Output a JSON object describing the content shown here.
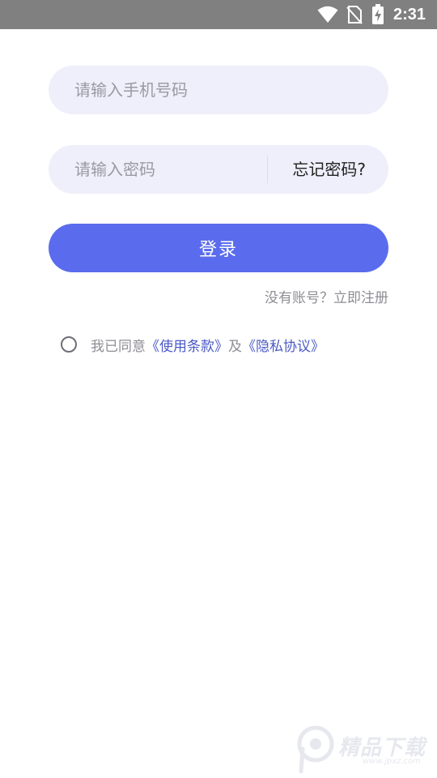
{
  "status_bar": {
    "time": "2:31",
    "icons": [
      "wifi-icon",
      "no-sim-icon",
      "battery-charging-icon"
    ]
  },
  "login_form": {
    "phone_placeholder": "请输入手机号码",
    "password_placeholder": "请输入密码",
    "forgot_password": "忘记密码?",
    "login_button": "登录",
    "register_link": "没有账号？立即注册"
  },
  "agreement": {
    "prefix": "我已同意",
    "terms_link": "《使用条款》",
    "conjunction": "及",
    "privacy_link": "《隐私协议》",
    "checked": false
  },
  "watermark": {
    "text": "精品下载",
    "sub": "www.jpxz.com"
  },
  "colors": {
    "accent": "#5a6ced",
    "field_bg": "#efeffb",
    "link": "#4b5ac6",
    "muted_text": "#8d8d95",
    "status_bar": "#808080"
  }
}
